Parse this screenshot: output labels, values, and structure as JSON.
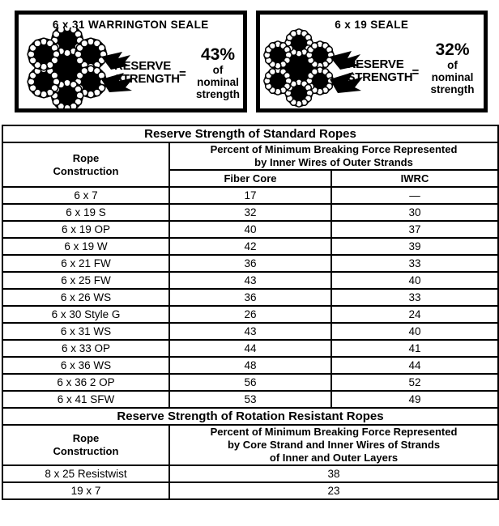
{
  "diagrams": [
    {
      "title": "6 x 31 WARRINGTON SEALE",
      "reserve_line1": "RESERVE",
      "reserve_line2": "STRENGTH",
      "equals": "=",
      "percent": "43%",
      "of": "of",
      "nominal": "nominal",
      "strength": "strength",
      "icon": "wire-rope-cross-section-icon"
    },
    {
      "title": "6 x 19 SEALE",
      "reserve_line1": "RESERVE",
      "reserve_line2": "STRENGTH",
      "equals": "=",
      "percent": "32%",
      "of": "of",
      "nominal": "nominal",
      "strength": "strength",
      "icon": "wire-rope-cross-section-icon"
    }
  ],
  "colors": {
    "header_background": "#dcdcdc",
    "border": "#000000",
    "cell_background": "#ffffff",
    "text": "#000000"
  },
  "standard_section": {
    "title": "Reserve Strength of Standard Ropes",
    "col1_header_line1": "Rope",
    "col1_header_line2": "Construction",
    "col23_header_line1": "Percent of Minimum Breaking Force Represented",
    "col23_header_line2": "by Inner Wires of Outer Strands",
    "col2_subheader": "Fiber Core",
    "col3_subheader": "IWRC",
    "rows": [
      {
        "construction": "6 x 7",
        "fiber_core": "17",
        "iwrc": "—"
      },
      {
        "construction": "6 x 19 S",
        "fiber_core": "32",
        "iwrc": "30"
      },
      {
        "construction": "6 x 19 OP",
        "fiber_core": "40",
        "iwrc": "37"
      },
      {
        "construction": "6 x 19 W",
        "fiber_core": "42",
        "iwrc": "39"
      },
      {
        "construction": "6 x 21 FW",
        "fiber_core": "36",
        "iwrc": "33"
      },
      {
        "construction": "6 x 25 FW",
        "fiber_core": "43",
        "iwrc": "40"
      },
      {
        "construction": "6 x 26 WS",
        "fiber_core": "36",
        "iwrc": "33"
      },
      {
        "construction": "6 x 30 Style G",
        "fiber_core": "26",
        "iwrc": "24"
      },
      {
        "construction": "6 x 31 WS",
        "fiber_core": "43",
        "iwrc": "40"
      },
      {
        "construction": "6 x 33 OP",
        "fiber_core": "44",
        "iwrc": "41"
      },
      {
        "construction": "6 x 36 WS",
        "fiber_core": "48",
        "iwrc": "44"
      },
      {
        "construction": "6 x 36 2 OP",
        "fiber_core": "56",
        "iwrc": "52"
      },
      {
        "construction": "6 x 41 SFW",
        "fiber_core": "53",
        "iwrc": "49"
      }
    ]
  },
  "rotation_section": {
    "title": "Reserve Strength of Rotation Resistant Ropes",
    "col1_header_line1": "Rope",
    "col1_header_line2": "Construction",
    "col2_header_line1": "Percent of Minimum Breaking Force Represented",
    "col2_header_line2": "by Core Strand and Inner Wires of Strands",
    "col2_header_line3": "of Inner and Outer Layers",
    "rows": [
      {
        "construction": "8 x 25 Resistwist",
        "percent": "38"
      },
      {
        "construction": "19 x 7",
        "percent": "23"
      }
    ]
  }
}
